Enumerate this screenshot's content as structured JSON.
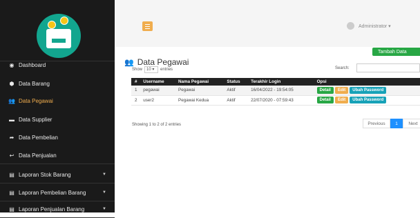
{
  "sidebar": {
    "items": [
      {
        "label": "Dashboard",
        "icon": "dashboard-icon",
        "glyph": "◉",
        "active": false
      },
      {
        "label": "Data Barang",
        "icon": "cubes-icon",
        "glyph": "⬢",
        "active": false
      },
      {
        "label": "Data Pegawai",
        "icon": "users-icon",
        "glyph": "👥",
        "active": true
      },
      {
        "label": "Data Supplier",
        "icon": "truck-icon",
        "glyph": "▬",
        "active": false
      },
      {
        "label": "Data Pembelian",
        "icon": "share-icon",
        "glyph": "➦",
        "active": false
      },
      {
        "label": "Data Penjualan",
        "icon": "reply-icon",
        "glyph": "↩",
        "active": false
      },
      {
        "label": "Laporan Stok Barang",
        "icon": "file-icon",
        "glyph": "▤",
        "active": false
      },
      {
        "label": "Laporan Pembelian Barang",
        "icon": "file-icon",
        "glyph": "▤",
        "active": false
      },
      {
        "label": "Laporan Penjualan Barang",
        "icon": "file-icon",
        "glyph": "▤",
        "active": false
      }
    ]
  },
  "topbar": {
    "user": "Administrator ▾"
  },
  "page": {
    "title": "Data Pegawai",
    "add_button": "Tambah Data"
  },
  "controls": {
    "show": "Show",
    "entries_value": "10",
    "entries": "entries",
    "search": "Search:"
  },
  "table": {
    "headers": [
      "#",
      "Username",
      "Nama Pegawai",
      "Status",
      "Terakhir Login",
      "Opsi"
    ],
    "rows": [
      [
        "1",
        "pegawai",
        "Pegawai",
        "Aktif",
        "16/04/2022 - 19:54:05"
      ],
      [
        "2",
        "user2",
        "Pegawai Kedua",
        "Aktif",
        "22/07/2020 - 07:59:43"
      ]
    ],
    "actions": [
      "Detail",
      "Edit",
      "Ubah Password"
    ]
  },
  "info": "Showing 1 to 2 of 2 entries",
  "pagination": {
    "previous": "Previous",
    "current": "1",
    "next": "Next"
  },
  "colors": {
    "sidebar": "#1a1a1a",
    "accent": "#f0ad4e",
    "green": "#28a745",
    "teal": "#17a2b8",
    "logo": "#12a68f"
  }
}
